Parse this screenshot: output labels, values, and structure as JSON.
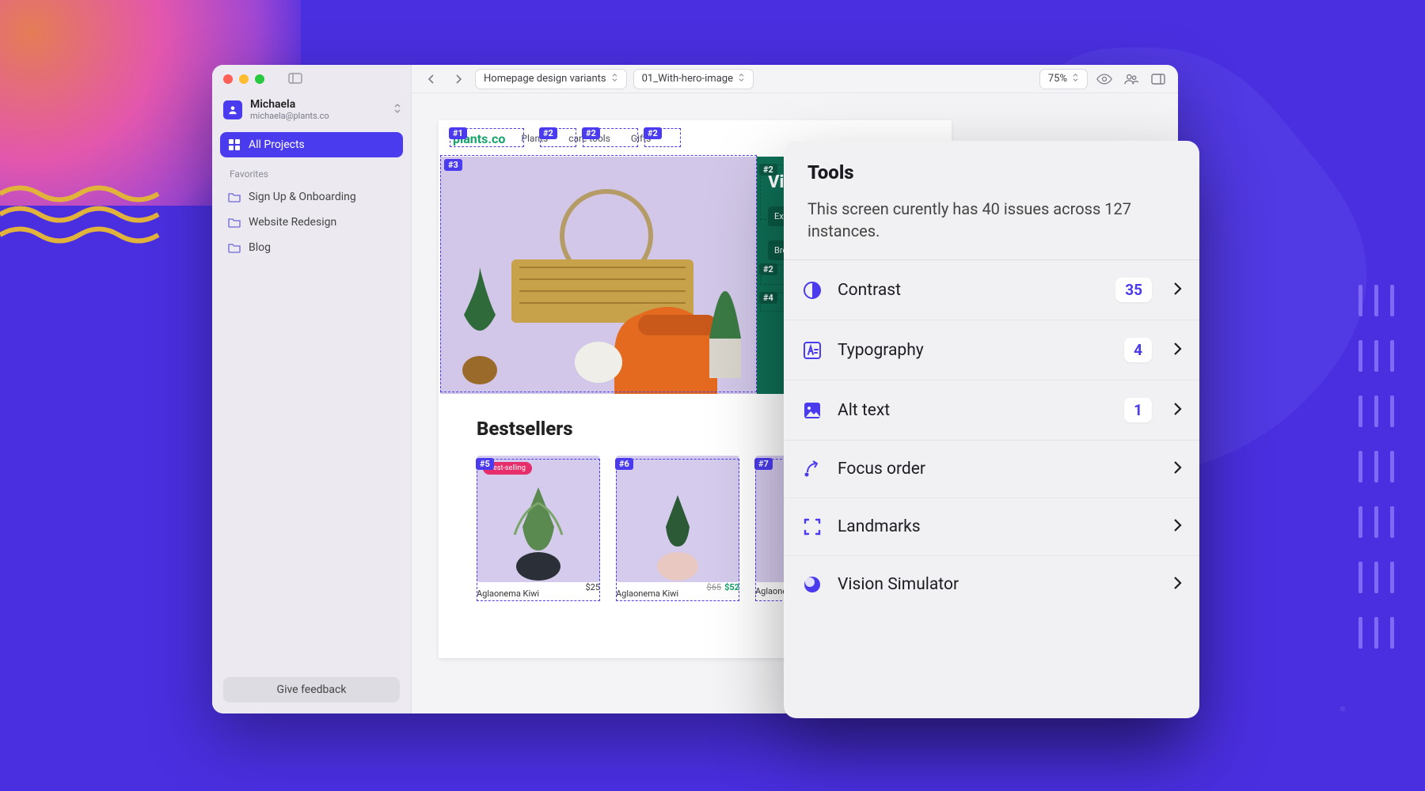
{
  "user": {
    "name": "Michaela",
    "email": "michaela@plants.co"
  },
  "nav": {
    "all_projects": "All Projects",
    "favorites_label": "Favorites",
    "items": [
      {
        "label": "Sign Up & Onboarding"
      },
      {
        "label": "Website Redesign"
      },
      {
        "label": "Blog"
      }
    ]
  },
  "feedback_button": "Give feedback",
  "toolbar": {
    "breadcrumb1": "Homepage design variants",
    "breadcrumb2": "01_With-hero-image",
    "zoom": "75%"
  },
  "artboard": {
    "logo1": "plants",
    "logo2": ".co",
    "nav_items": [
      "Plants",
      "care tools",
      "Gifts"
    ],
    "promo_title": "Vibrant house plants",
    "promo_tags": [
      "Expert care tips we provide",
      "Browse plants"
    ],
    "best_title": "Bestsellers",
    "cards": [
      {
        "name": "Aglaonema Kiwi",
        "price": "$25",
        "badge": "best-selling"
      },
      {
        "name": "Aglaonema Kiwi",
        "old": "$65",
        "new": "$52"
      },
      {
        "name": "Aglaonema"
      }
    ],
    "annotations": [
      "#1",
      "#2",
      "#2",
      "#2",
      "#2",
      "#3",
      "#2",
      "#4",
      "#5",
      "#6",
      "#7"
    ]
  },
  "tools": {
    "title": "Tools",
    "subtitle": "This screen curently has 40 issues across 127 instances.",
    "items": [
      {
        "label": "Contrast",
        "count": "35"
      },
      {
        "label": "Typography",
        "count": "4"
      },
      {
        "label": "Alt text",
        "count": "1"
      },
      {
        "label": "Focus order"
      },
      {
        "label": "Landmarks"
      },
      {
        "label": "Vision Simulator"
      }
    ]
  }
}
